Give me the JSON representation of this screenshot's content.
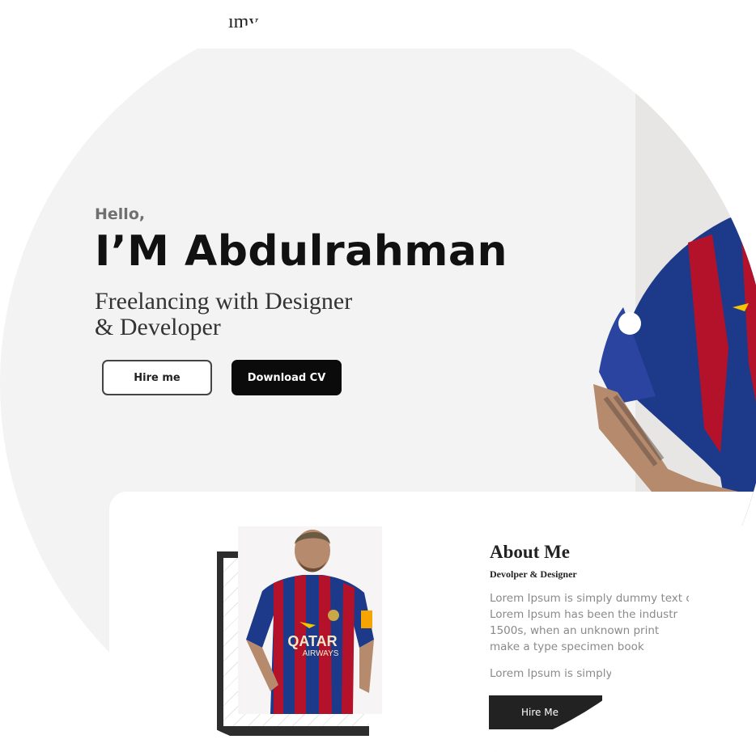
{
  "header": {
    "fragment_text": "ımy"
  },
  "hero": {
    "greeting": "Hello,",
    "name": "I’M Abdulrahman",
    "tagline_line1": "Freelancing with Designer",
    "tagline_line2": "& Developer",
    "hire_button": "Hire me",
    "cv_button": "Download CV"
  },
  "about": {
    "title": "About Me",
    "subtitle": "Devolper & Designer",
    "paragraph_lines": [
      "Lorem Ipsum is simply dummy text c",
      "Lorem Ipsum has been the industr",
      "1500s, when an unknown print",
      "make a type specimen book"
    ],
    "paragraph2": "Lorem Ipsum is simply",
    "button": "Hire Me"
  },
  "colors": {
    "background": "#f3f3f3",
    "primary_dark": "#0b0b0b",
    "text": "#111111",
    "muted": "#8a8a8a"
  },
  "images": {
    "hero_photo": "footballer-photo",
    "about_photo": "footballer-photo"
  }
}
